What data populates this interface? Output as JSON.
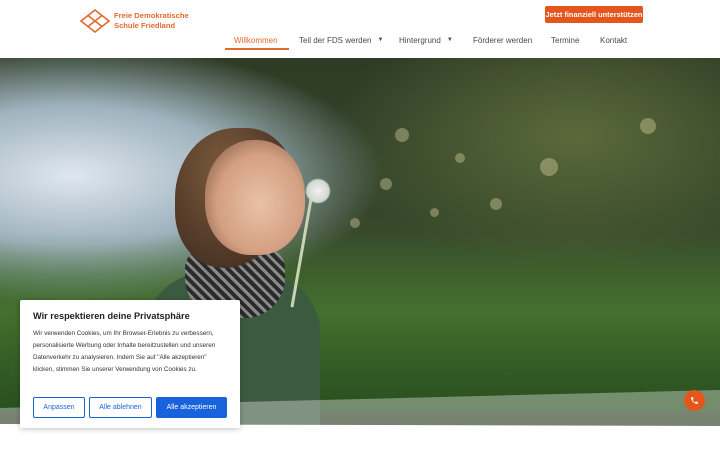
{
  "brand": {
    "line1": "Freie Demokratische",
    "line2": "Schule Friedland",
    "accent_color": "#e4692e"
  },
  "header": {
    "cta_label": "Jetzt finanziell unterstützen"
  },
  "nav": {
    "items": [
      {
        "label": "Willkommen",
        "active": true,
        "has_dropdown": false
      },
      {
        "label": "Teil der FDS werden",
        "active": false,
        "has_dropdown": true
      },
      {
        "label": "Hintergrund",
        "active": false,
        "has_dropdown": true
      },
      {
        "label": "Förderer werden",
        "active": false,
        "has_dropdown": false
      },
      {
        "label": "Termine",
        "active": false,
        "has_dropdown": false
      },
      {
        "label": "Kontakt",
        "active": false,
        "has_dropdown": false
      }
    ]
  },
  "cookie": {
    "title": "Wir respektieren deine Privatsphäre",
    "text": "Wir verwenden Cookies, um Ihr Browser-Erlebnis zu verbessern, personalisierte Werbung oder Inhalte bereitzustellen und unseren Datenverkehr zu analysieren. Indem Sie auf \"Alle akzeptieren\" klicken, stimmen Sie unserer Verwendung von Cookies zu.",
    "customize_label": "Anpassen",
    "reject_label": "Alle ablehnen",
    "accept_label": "Alle akzeptieren",
    "button_color": "#1863dc"
  },
  "floating": {
    "phone_icon": "phone-icon"
  }
}
